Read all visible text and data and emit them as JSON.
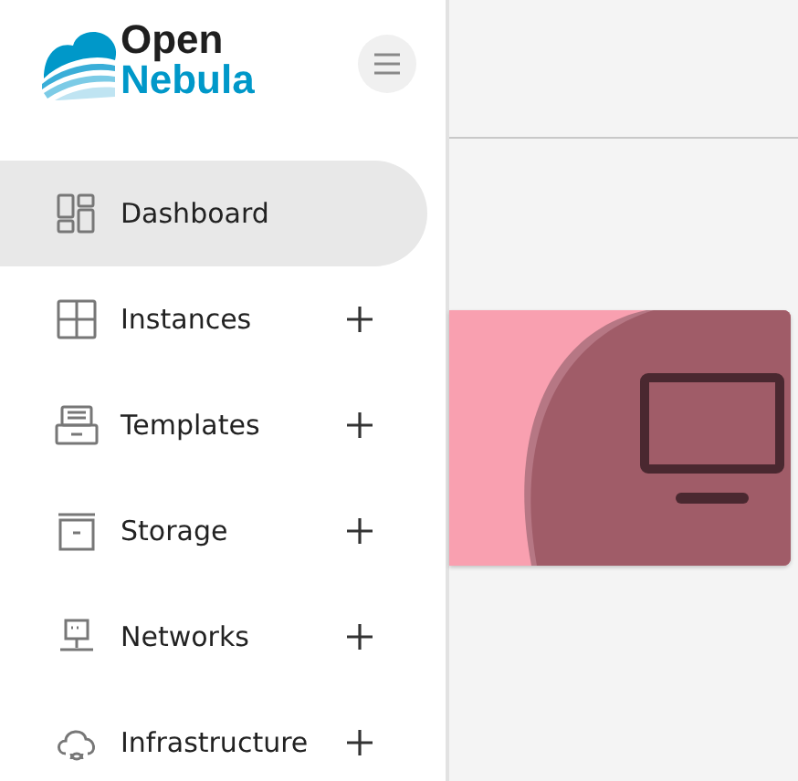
{
  "logo": {
    "line_1": "Open",
    "line_2": "Nebula"
  },
  "menu": [
    {
      "label": "Dashboard",
      "selected": true,
      "expandable": false
    },
    {
      "label": "Instances",
      "selected": false,
      "expandable": true
    },
    {
      "label": "Templates",
      "selected": false,
      "expandable": true
    },
    {
      "label": "Storage",
      "selected": false,
      "expandable": true
    },
    {
      "label": "Networks",
      "selected": false,
      "expandable": true
    },
    {
      "label": "Infrastructure",
      "selected": false,
      "expandable": true
    }
  ]
}
